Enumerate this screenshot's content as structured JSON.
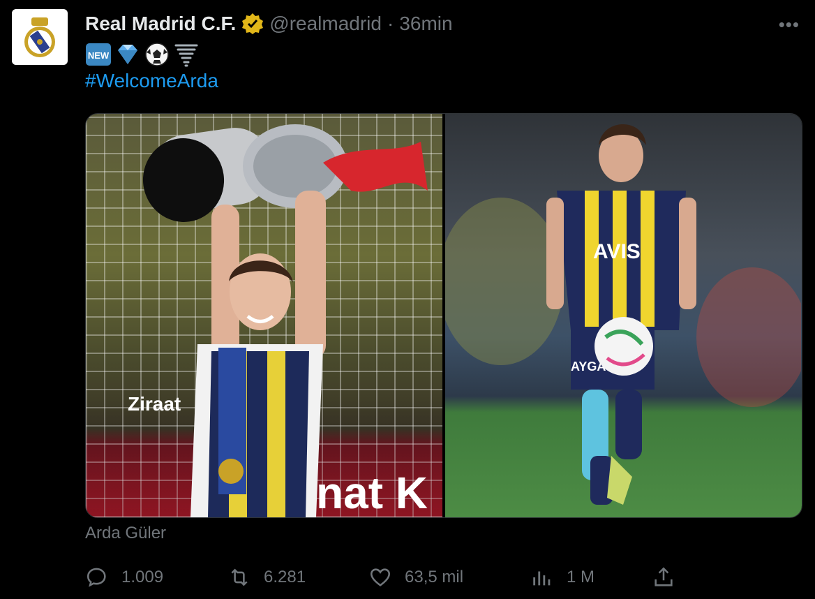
{
  "tweet": {
    "author_name": "Real Madrid C.F.",
    "handle": "@realmadrid",
    "separator": "·",
    "time": "36min",
    "more_label": "•••",
    "emoji_icons": [
      "new-button-emoji-icon",
      "gem-emoji-icon",
      "soccer-ball-emoji-icon",
      "tornado-emoji-icon"
    ],
    "hashtag": "#WelcomeArda",
    "media_caption": "Arda Güler",
    "media": [
      {
        "icon": "photo-trophy-celebration"
      },
      {
        "icon": "photo-player-with-ball"
      }
    ]
  },
  "actions": {
    "replies": "1.009",
    "reposts": "6.281",
    "likes": "63,5 mil",
    "views": "1 M"
  },
  "colors": {
    "background": "#000000",
    "text": "#e7e9ea",
    "muted": "#71767b",
    "link": "#1d9bf0",
    "verified_badge": "#e2b719"
  }
}
